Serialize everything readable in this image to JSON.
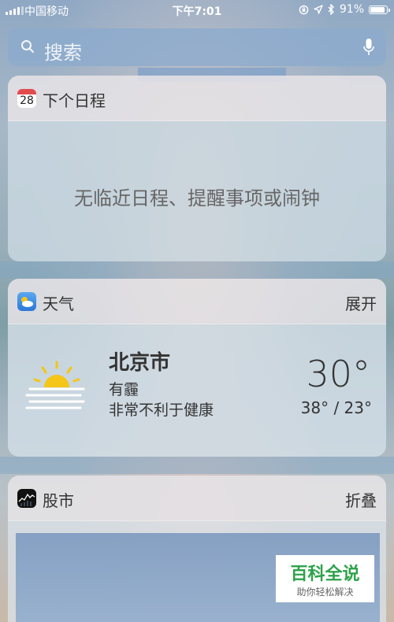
{
  "status_bar": {
    "carrier": "中国移动",
    "time": "下午7:01",
    "battery": "91%",
    "battery_level": 0.91,
    "icons": [
      "signal-icon",
      "orientation-lock-icon",
      "location-icon",
      "bluetooth-icon",
      "battery-icon"
    ]
  },
  "search": {
    "placeholder": "搜索",
    "icons": [
      "search-icon",
      "microphone-icon"
    ]
  },
  "calendar_widget": {
    "title": "下个日程",
    "icon_day": "28",
    "empty_message": "无临近日程、提醒事项或闹钟"
  },
  "weather_widget": {
    "title": "天气",
    "action": "展开",
    "city": "北京市",
    "condition": "有霾",
    "advice": "非常不利于健康",
    "temperature": "30°",
    "range": "38° / 23°"
  },
  "stocks_widget": {
    "title": "股市",
    "action": "折叠"
  },
  "watermark": {
    "title": "百科全说",
    "subtitle": "助你轻松解决"
  },
  "colors": {
    "calendar_red": "#e24b4b",
    "weather_blue": "#2b78d8",
    "sun_yellow": "#f5c518",
    "watermark_green": "#2ea24a"
  }
}
